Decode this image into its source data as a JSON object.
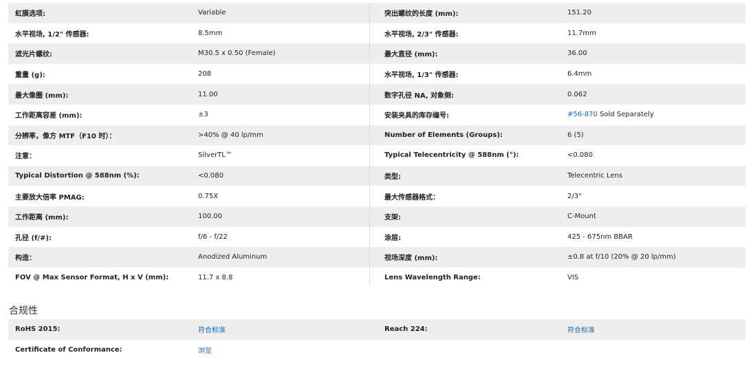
{
  "specs": [
    {
      "l1": "虹膜选项:",
      "v1": "Variable",
      "l2": "突出螺纹的长度 (mm):",
      "v2": "151.20"
    },
    {
      "l1": "水平视场, 1/2\" 传感器:",
      "v1": "8.5mm",
      "l2": "水平视场, 2/3\" 传感器:",
      "v2": "11.7mm"
    },
    {
      "l1": "滤光片螺纹:",
      "v1": "M30.5 x 0.50 (Female)",
      "l2": "最大直径 (mm):",
      "v2": "36.00"
    },
    {
      "l1": "重量 (g):",
      "v1": "208",
      "l2": "水平视场, 1/3\" 传感器:",
      "v2": "6.4mm"
    },
    {
      "l1": "最大像圈 (mm):",
      "v1": "11.00",
      "l2": "数字孔径 NA, 对象侧:",
      "v2": "0.062"
    },
    {
      "l1": "工作距离容差 (mm):",
      "v1": "±3",
      "l2": "安装夹具的库存编号:",
      "v2_link": "#56-870",
      "v2": " Sold Separately"
    },
    {
      "l1": "分辨率，像方 MTF（F10 时）：",
      "v1": ">40% @ 40 lp/mm",
      "l2": "Number of Elements (Groups):",
      "v2": "6 (5)"
    },
    {
      "l1": "注意：",
      "v1": "SilverTL™",
      "l2": "Typical Telecentricity @ 588nm (°):",
      "v2": "<0.080"
    },
    {
      "l1": "Typical Distortion @ 588nm (%):",
      "v1": "<0.080",
      "l2": "类型:",
      "v2": "Telecentric Lens"
    },
    {
      "l1": "主要放大倍率 PMAG:",
      "v1": "0.75X",
      "l2": "最大传感器格式：",
      "v2": "2/3\""
    },
    {
      "l1": "工作距离 (mm):",
      "v1": "100.00",
      "l2": "支架:",
      "v2": "C-Mount"
    },
    {
      "l1": "孔径 (f/#):",
      "v1": "f/6 - f/22",
      "l2": "涂层:",
      "v2": "425 - 675nm BBAR"
    },
    {
      "l1": "构造：",
      "v1": "Anodized Aluminum",
      "l2": "视场深度 (mm):",
      "v2": "±0.8 at f/10 (20% @ 20 lp/mm)"
    },
    {
      "l1": "FOV @ Max Sensor Format, H x V (mm):",
      "v1": "11.7 x 8.8",
      "l2": "Lens Wavelength Range:",
      "v2": "VIS"
    }
  ],
  "compliance": {
    "title": "合规性",
    "rows": [
      {
        "l1": "RoHS 2015:",
        "v1": "符合标准",
        "l2": "Reach 224:",
        "v2": "符合标准"
      },
      {
        "l1": "Certificate of Conformance:",
        "v1": "浏览",
        "l2": "",
        "v2": ""
      }
    ]
  },
  "colors": {
    "link": "#1a66b3",
    "shade": "#eeeeee"
  }
}
